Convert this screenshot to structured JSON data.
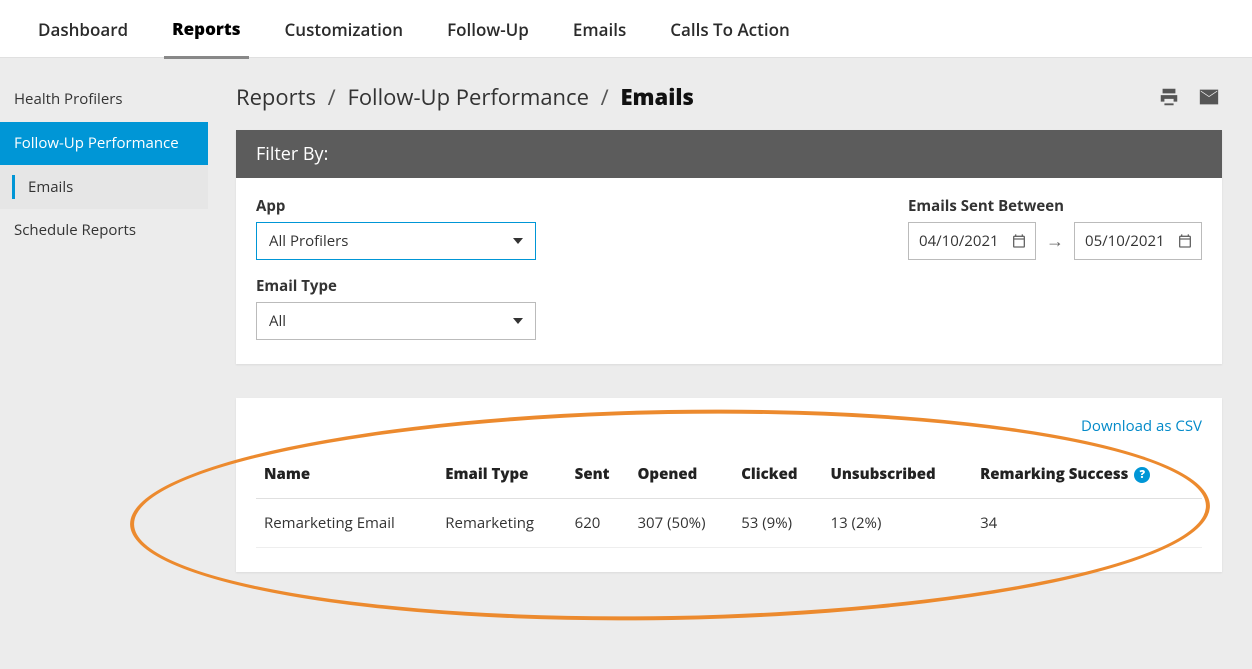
{
  "topnav": {
    "items": [
      "Dashboard",
      "Reports",
      "Customization",
      "Follow-Up",
      "Emails",
      "Calls To Action"
    ],
    "active_index": 1
  },
  "sidebar": {
    "items": [
      {
        "label": "Health Profilers"
      },
      {
        "label": "Follow-Up Performance"
      },
      {
        "label": "Emails"
      },
      {
        "label": "Schedule Reports"
      }
    ]
  },
  "breadcrumb": {
    "root": "Reports",
    "mid": "Follow-Up Performance",
    "current": "Emails"
  },
  "filter": {
    "title": "Filter By:",
    "app_label": "App",
    "app_value": "All Profilers",
    "email_type_label": "Email Type",
    "email_type_value": "All",
    "date_label": "Emails Sent Between",
    "date_from": "04/10/2021",
    "date_to": "05/10/2021"
  },
  "results": {
    "download_label": "Download as CSV",
    "columns": [
      "Name",
      "Email Type",
      "Sent",
      "Opened",
      "Clicked",
      "Unsubscribed",
      "Remarking Success"
    ],
    "help_symbol": "?",
    "rows": [
      {
        "name": "Remarketing Email",
        "email_type": "Remarketing",
        "sent": "620",
        "opened": "307 (50%)",
        "clicked": "53 (9%)",
        "unsubscribed": "13 (2%)",
        "remarking_success": "34"
      }
    ]
  }
}
